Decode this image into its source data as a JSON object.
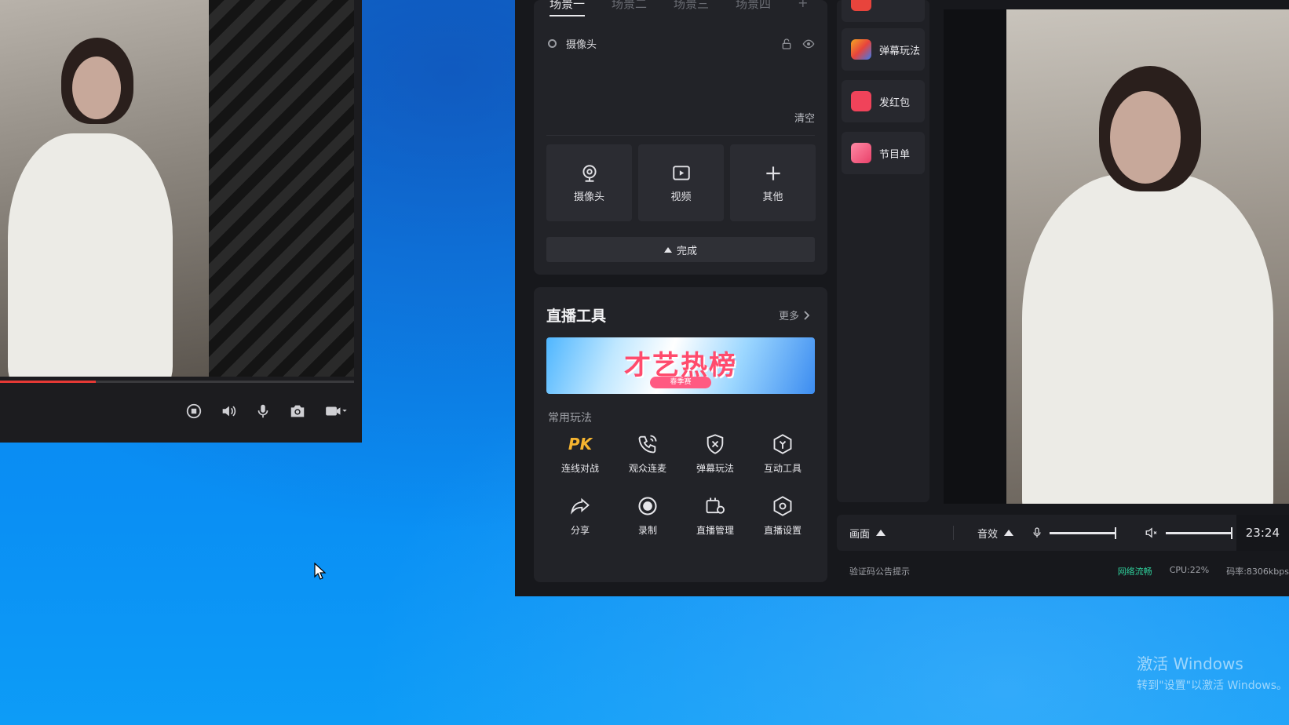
{
  "player": {
    "progress_fraction": 0.27,
    "controls": [
      "stop-icon",
      "volume-icon",
      "mic-icon",
      "camera-icon",
      "video-camera-icon"
    ]
  },
  "scene_panel": {
    "tabs": [
      "场景一",
      "场景二",
      "场景三",
      "场景四"
    ],
    "tab_add": "+",
    "source_name": "摄像头",
    "clear_label": "清空",
    "source_buttons": [
      {
        "label": "摄像头",
        "icon": "webcam-icon"
      },
      {
        "label": "视频",
        "icon": "video-play-icon"
      },
      {
        "label": "其他",
        "icon": "plus-icon"
      }
    ],
    "done_label": "完成"
  },
  "tools_panel": {
    "title": "直播工具",
    "more_label": "更多",
    "banner_title": "才艺热榜",
    "banner_sub": "春季赛",
    "section_label": "常用玩法",
    "tools": [
      {
        "label": "连线对战",
        "icon": "pk-icon"
      },
      {
        "label": "观众连麦",
        "icon": "phone-call-icon"
      },
      {
        "label": "弹幕玩法",
        "icon": "danmaku-shield-icon"
      },
      {
        "label": "互动工具",
        "icon": "interact-hexagon-icon"
      },
      {
        "label": "分享",
        "icon": "share-icon"
      },
      {
        "label": "录制",
        "icon": "record-icon"
      },
      {
        "label": "直播管理",
        "icon": "live-manage-icon"
      },
      {
        "label": "直播设置",
        "icon": "settings-hexagon-icon"
      }
    ],
    "pk_text": "PK"
  },
  "side_panel": {
    "items": [
      {
        "label": "弹幕玩法",
        "icon": "danmaku-app-icon",
        "color": "#e8443c"
      },
      {
        "label": "发红包",
        "icon": "red-envelope-icon",
        "color": "#f0435a"
      },
      {
        "label": "节目单",
        "icon": "program-list-icon",
        "color": "#e9416a"
      }
    ]
  },
  "bottom_bar": {
    "picture_label": "画面",
    "audio_label": "音效",
    "time": "23:24",
    "status_left": "验证码公告提示",
    "network": "网络流畅",
    "cpu": "CPU:22%",
    "bitrate": "码率:8306kbps"
  },
  "watermark": {
    "line1": "激活 Windows",
    "line2": "转到\"设置\"以激活 Windows。"
  },
  "colors": {
    "accent_red": "#e53935",
    "network_ok": "#2fce9a",
    "panel_bg": "#222328"
  }
}
